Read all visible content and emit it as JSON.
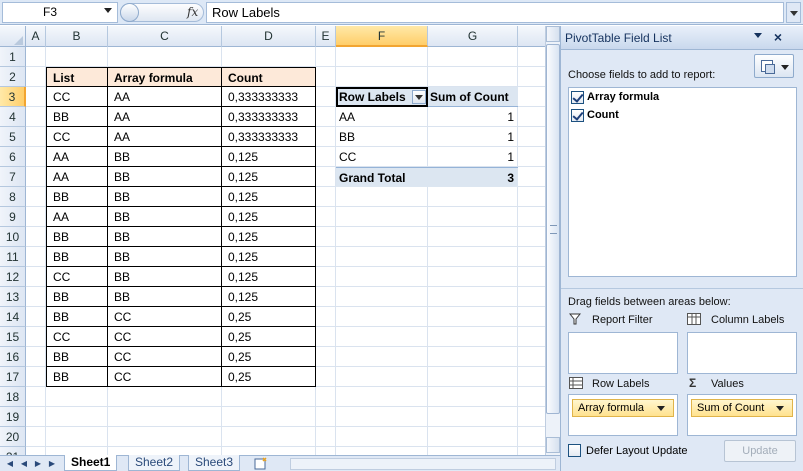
{
  "formula_bar": {
    "name_box": "F3",
    "fx_label": "fx",
    "formula": "Row Labels"
  },
  "grid": {
    "columns": [
      "A",
      "B",
      "C",
      "D",
      "E",
      "F",
      "G"
    ],
    "selected_column": "F",
    "rows": [
      "1",
      "2",
      "3",
      "4",
      "5",
      "6",
      "7",
      "8",
      "9",
      "10",
      "11",
      "12",
      "13",
      "14",
      "15",
      "16",
      "17",
      "18",
      "19",
      "20",
      "21"
    ],
    "selected_row": "3"
  },
  "source_table": {
    "headers": [
      "List",
      "Array formula",
      "Count"
    ],
    "rows": [
      [
        "CC",
        "AA",
        "0,333333333"
      ],
      [
        "BB",
        "AA",
        "0,333333333"
      ],
      [
        "CC",
        "AA",
        "0,333333333"
      ],
      [
        "AA",
        "BB",
        "0,125"
      ],
      [
        "AA",
        "BB",
        "0,125"
      ],
      [
        "BB",
        "BB",
        "0,125"
      ],
      [
        "AA",
        "BB",
        "0,125"
      ],
      [
        "BB",
        "BB",
        "0,125"
      ],
      [
        "BB",
        "BB",
        "0,125"
      ],
      [
        "CC",
        "BB",
        "0,125"
      ],
      [
        "BB",
        "BB",
        "0,125"
      ],
      [
        "BB",
        "CC",
        "0,25"
      ],
      [
        "CC",
        "CC",
        "0,25"
      ],
      [
        "BB",
        "CC",
        "0,25"
      ],
      [
        "BB",
        "CC",
        "0,25"
      ]
    ]
  },
  "pivot_table": {
    "header_row_labels": "Row Labels",
    "header_sum": "Sum of Count",
    "rows": [
      {
        "label": "AA",
        "value": "1"
      },
      {
        "label": "BB",
        "value": "1"
      },
      {
        "label": "CC",
        "value": "1"
      }
    ],
    "total_label": "Grand Total",
    "total_value": "3"
  },
  "sheet_tabs": {
    "tabs": [
      "Sheet1",
      "Sheet2",
      "Sheet3"
    ],
    "active": "Sheet1"
  },
  "pivot_panel": {
    "title": "PivotTable Field List",
    "choose_label": "Choose fields to add to report:",
    "fields": [
      {
        "name": "Array formula",
        "checked": true
      },
      {
        "name": "Count",
        "checked": true
      }
    ],
    "drag_label": "Drag fields between areas below:",
    "report_filter_label": "Report Filter",
    "column_labels_label": "Column Labels",
    "row_labels_label": "Row Labels",
    "values_label": "Values",
    "row_labels_field": "Array formula",
    "values_field": "Sum of Count",
    "defer_label": "Defer Layout Update",
    "update_label": "Update",
    "values_icon": "Σ"
  }
}
